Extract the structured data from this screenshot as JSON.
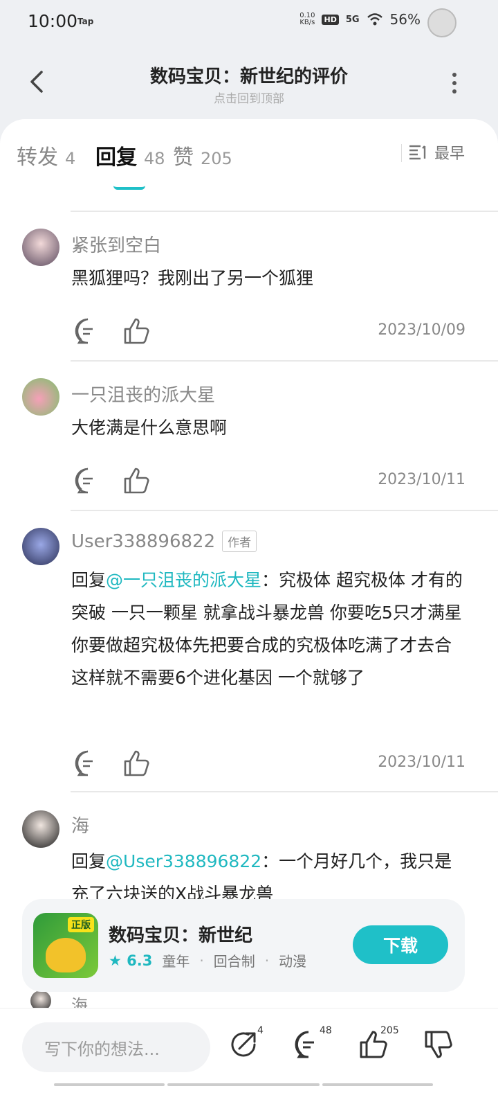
{
  "status": {
    "time": "10:00",
    "tap": "Tap",
    "net_speed": "0.10",
    "net_unit": "KB/s",
    "hd": "HD",
    "signal": "5G",
    "battery": "56%"
  },
  "nav": {
    "title": "数码宝贝：新世纪的评价",
    "subtitle": "点击回到顶部"
  },
  "tabs": [
    {
      "label": "转发",
      "count": "4"
    },
    {
      "label": "回复",
      "count": "48"
    },
    {
      "label": "赞",
      "count": "205"
    }
  ],
  "sort": {
    "label": "最早"
  },
  "comments": [
    {
      "name": "紧张到空白",
      "badge": "",
      "text": "黑狐狸吗？我刚出了另一个狐狸",
      "date": "2023/10/09"
    },
    {
      "name": "一只沮丧的派大星",
      "badge": "",
      "text": "大佬满是什么意思啊",
      "date": "2023/10/11"
    },
    {
      "name": "User338896822",
      "badge": "作者",
      "reply_prefix": "回复",
      "mention": "@一只沮丧的派大星",
      "text": "：究极体 超究极体 才有的突破 一只一颗星 就拿战斗暴龙兽 你要吃5只才满星 你要做超究极体先把要合成的究极体吃满了才去合 这样就不需要6个进化基因 一个就够了",
      "date": "2023/10/11"
    },
    {
      "name": "海",
      "badge": "",
      "reply_prefix": "回复",
      "mention": "@User338896822",
      "text": "：一个月好几个，我只是充了六块送的X战斗暴龙兽",
      "date": ""
    }
  ],
  "partial_next_name": "海",
  "promo": {
    "name": "数码宝贝：新世纪",
    "rating": "6.3",
    "tags": [
      "童年",
      "回合制",
      "动漫"
    ],
    "download": "下载",
    "logo_badge": "正版"
  },
  "bottom": {
    "placeholder": "写下你的想法...",
    "share_count": "4",
    "reply_count": "48",
    "like_count": "205"
  }
}
